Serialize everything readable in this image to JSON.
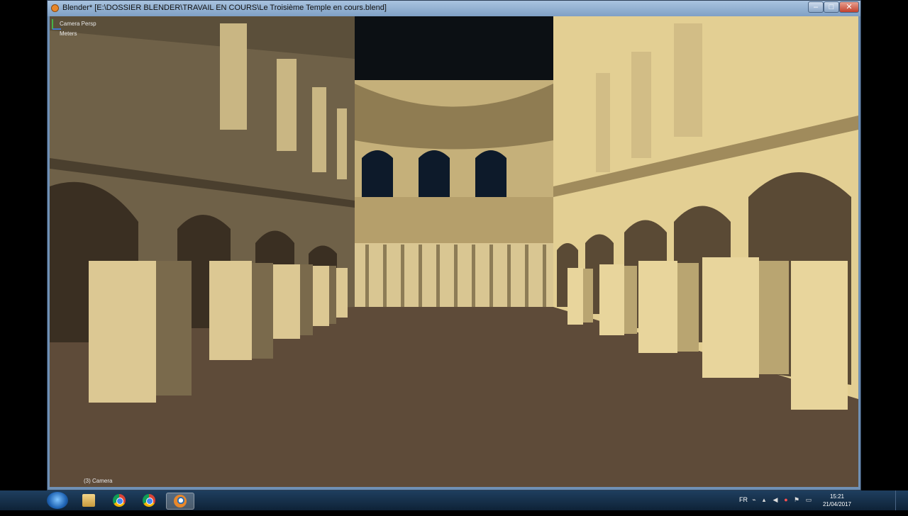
{
  "window": {
    "title": "Blender* [E:\\DOSSIER BLENDER\\TRAVAIL EN COURS\\Le Troisième Temple en cours.blend]",
    "minimize_glyph": "–",
    "maximize_glyph": "□",
    "close_glyph": "✕"
  },
  "viewport": {
    "camera_label": "Camera Persp",
    "units_label": "Meters",
    "object_label": "(3) Camera"
  },
  "taskbar": {
    "items": [
      {
        "name": "start-button"
      },
      {
        "name": "windows-explorer"
      },
      {
        "name": "google-chrome"
      },
      {
        "name": "google-chrome"
      },
      {
        "name": "blender",
        "active": true
      }
    ],
    "language": "FR",
    "time": "15:21",
    "date": "21/04/2017"
  },
  "colors": {
    "sandstone": "#e3cf93",
    "shadow_stone": "#6f6148",
    "floor": "#5c4a38",
    "sky": "#0c1014"
  }
}
